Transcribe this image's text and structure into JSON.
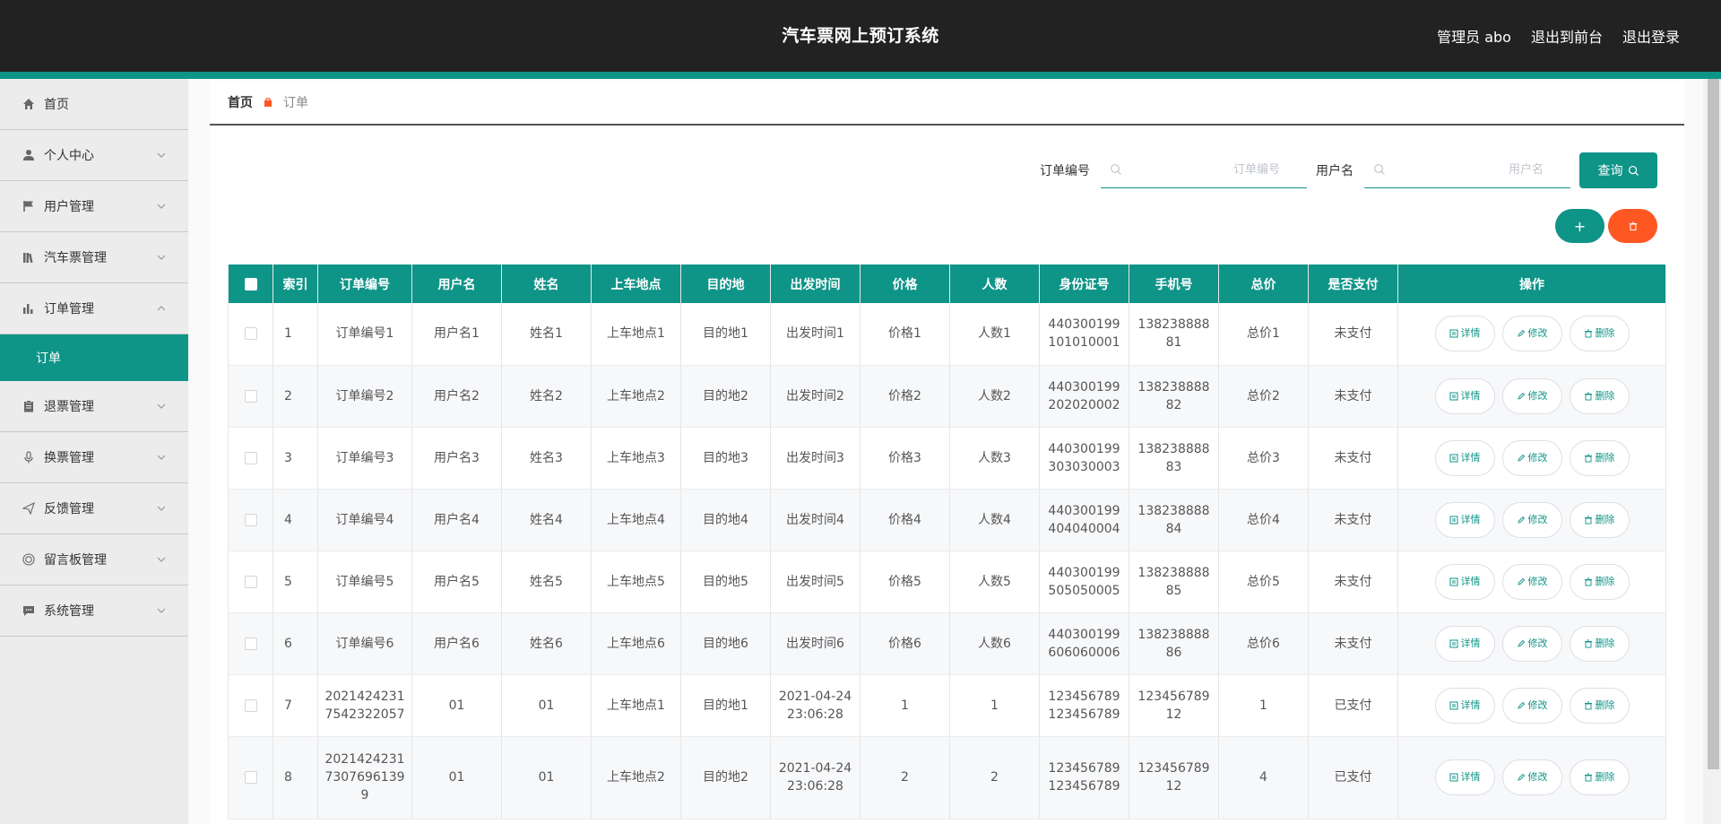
{
  "header": {
    "title": "汽车票网上预订系统",
    "user": "管理员 abo",
    "to_front": "退出到前台",
    "logout": "退出登录"
  },
  "sidebar": {
    "items": [
      {
        "label": "首页",
        "icon": "home-icon",
        "has_chevron": false
      },
      {
        "label": "个人中心",
        "icon": "user-icon",
        "has_chevron": true
      },
      {
        "label": "用户管理",
        "icon": "flag-icon",
        "has_chevron": true
      },
      {
        "label": "汽车票管理",
        "icon": "library-icon",
        "has_chevron": true
      },
      {
        "label": "订单管理",
        "icon": "bar-chart-icon",
        "has_chevron": true,
        "expanded": true
      },
      {
        "label": "退票管理",
        "icon": "clipboard-icon",
        "has_chevron": true
      },
      {
        "label": "换票管理",
        "icon": "microphone-icon",
        "has_chevron": true
      },
      {
        "label": "反馈管理",
        "icon": "send-icon",
        "has_chevron": true
      },
      {
        "label": "留言板管理",
        "icon": "target-icon",
        "has_chevron": true
      },
      {
        "label": "系统管理",
        "icon": "chat-icon",
        "has_chevron": true
      }
    ],
    "active_sub": "订单"
  },
  "breadcrumb": {
    "home": "首页",
    "current": "订单"
  },
  "search": {
    "order_label": "订单编号",
    "order_placeholder": "订单编号",
    "user_label": "用户名",
    "user_placeholder": "用户名",
    "query_label": "查询"
  },
  "actions": {
    "add": "+"
  },
  "table": {
    "headers": [
      "索引",
      "订单编号",
      "用户名",
      "姓名",
      "上车地点",
      "目的地",
      "出发时间",
      "价格",
      "人数",
      "身份证号",
      "手机号",
      "总价",
      "是否支付",
      "操作"
    ],
    "op_labels": {
      "detail": "详情",
      "edit": "修改",
      "delete": "删除"
    },
    "rows": [
      {
        "idx": "1",
        "order": "订单编号1",
        "username": "用户名1",
        "name": "姓名1",
        "board": "上车地点1",
        "dest": "目的地1",
        "depart": "出发时间1",
        "price": "价格1",
        "count": "人数1",
        "idcard": "440300199 101010001",
        "phone": "138238888 81",
        "total": "总价1",
        "paid": "未支付"
      },
      {
        "idx": "2",
        "order": "订单编号2",
        "username": "用户名2",
        "name": "姓名2",
        "board": "上车地点2",
        "dest": "目的地2",
        "depart": "出发时间2",
        "price": "价格2",
        "count": "人数2",
        "idcard": "440300199 202020002",
        "phone": "138238888 82",
        "total": "总价2",
        "paid": "未支付"
      },
      {
        "idx": "3",
        "order": "订单编号3",
        "username": "用户名3",
        "name": "姓名3",
        "board": "上车地点3",
        "dest": "目的地3",
        "depart": "出发时间3",
        "price": "价格3",
        "count": "人数3",
        "idcard": "440300199 303030003",
        "phone": "138238888 83",
        "total": "总价3",
        "paid": "未支付"
      },
      {
        "idx": "4",
        "order": "订单编号4",
        "username": "用户名4",
        "name": "姓名4",
        "board": "上车地点4",
        "dest": "目的地4",
        "depart": "出发时间4",
        "price": "价格4",
        "count": "人数4",
        "idcard": "440300199 404040004",
        "phone": "138238888 84",
        "total": "总价4",
        "paid": "未支付"
      },
      {
        "idx": "5",
        "order": "订单编号5",
        "username": "用户名5",
        "name": "姓名5",
        "board": "上车地点5",
        "dest": "目的地5",
        "depart": "出发时间5",
        "price": "价格5",
        "count": "人数5",
        "idcard": "440300199 505050005",
        "phone": "138238888 85",
        "total": "总价5",
        "paid": "未支付"
      },
      {
        "idx": "6",
        "order": "订单编号6",
        "username": "用户名6",
        "name": "姓名6",
        "board": "上车地点6",
        "dest": "目的地6",
        "depart": "出发时间6",
        "price": "价格6",
        "count": "人数6",
        "idcard": "440300199 606060006",
        "phone": "138238888 86",
        "total": "总价6",
        "paid": "未支付"
      },
      {
        "idx": "7",
        "order": "2021424231 7542322057",
        "username": "01",
        "name": "01",
        "board": "上车地点1",
        "dest": "目的地1",
        "depart": "2021-04-24 23:06:28",
        "price": "1",
        "count": "1",
        "idcard": "123456789 123456789",
        "phone": "123456789 12",
        "total": "1",
        "paid": "已支付"
      },
      {
        "idx": "8",
        "order": "2021424231 7307696139 9",
        "username": "01",
        "name": "01",
        "board": "上车地点2",
        "dest": "目的地2",
        "depart": "2021-04-24 23:06:28",
        "price": "2",
        "count": "2",
        "idcard": "123456789 123456789",
        "phone": "123456789 12",
        "total": "4",
        "paid": "已支付"
      }
    ]
  },
  "colors": {
    "accent": "#0f9488",
    "danger": "#ff5722",
    "header_bg": "#222222"
  }
}
